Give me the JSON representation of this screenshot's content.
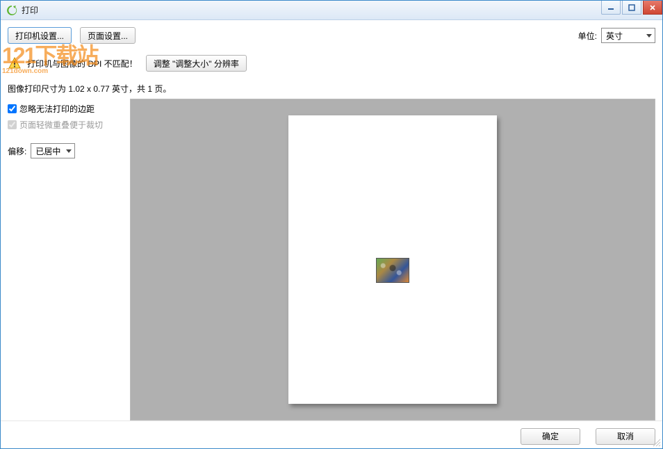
{
  "titlebar": {
    "title": "打印"
  },
  "toolbar": {
    "printer_settings": "打印机设置...",
    "page_setup": "页面设置...",
    "unit_label": "单位:",
    "unit_value": "英寸"
  },
  "warning": {
    "text": "打印机与图像的 DPI 不匹配！",
    "fix_button": "调整 \"调整大小\" 分辨率"
  },
  "size_info": "图像打印尺寸为 1.02 x 0.77 英寸，共 1 页。",
  "options": {
    "ignore_margins": {
      "label": "忽略无法打印的边距",
      "checked": true,
      "enabled": true
    },
    "overlap_pages": {
      "label": "页面轻微重叠便于裁切",
      "checked": true,
      "enabled": false
    },
    "offset_label": "偏移:",
    "offset_value": "已居中"
  },
  "footer": {
    "ok": "确定",
    "cancel": "取消"
  },
  "watermark": {
    "main": "121下载站",
    "sub": "121down.com"
  }
}
